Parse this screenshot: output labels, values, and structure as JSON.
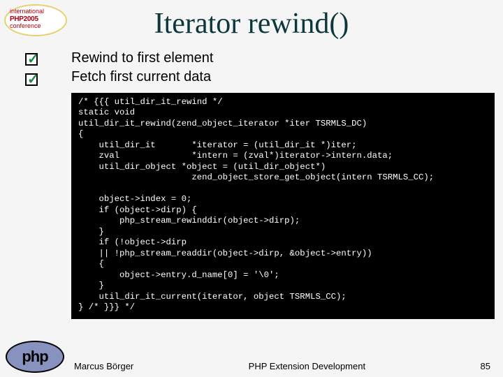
{
  "badge": {
    "line1": "international",
    "line2": "PHP2005",
    "line3": "conference"
  },
  "title": "Iterator rewind()",
  "bullets": [
    "Rewind to first element",
    "Fetch first current data"
  ],
  "code": "/* {{{ util_dir_it_rewind */\nstatic void\nutil_dir_it_rewind(zend_object_iterator *iter TSRMLS_DC)\n{\n    util_dir_it       *iterator = (util_dir_it *)iter;\n    zval              *intern = (zval*)iterator->intern.data;\n    util_dir_object *object = (util_dir_object*)\n                      zend_object_store_get_object(intern TSRMLS_CC);\n\n    object->index = 0;\n    if (object->dirp) {\n        php_stream_rewinddir(object->dirp);\n    }\n    if (!object->dirp\n    || !php_stream_readdir(object->dirp, &object->entry))\n    {\n        object->entry.d_name[0] = '\\0';\n    }\n    util_dir_it_current(iterator, object TSRMLS_CC);\n} /* }}} */",
  "footer": {
    "author": "Marcus Börger",
    "mid": "PHP Extension Development",
    "page": "85"
  },
  "logo": {
    "text": "php"
  }
}
